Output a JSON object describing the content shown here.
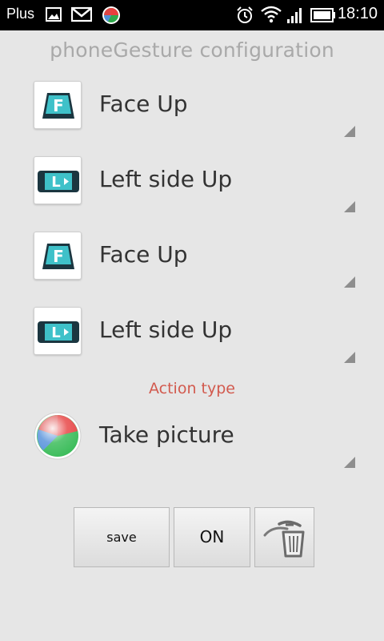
{
  "status_bar": {
    "carrier": "Plus",
    "time": "18:10",
    "icons": [
      "image-icon",
      "gmail-icon",
      "app-orb-icon",
      "alarm-icon",
      "wifi-icon",
      "signal-icon",
      "battery-icon"
    ]
  },
  "title": "phoneGesture configuration",
  "gestures": [
    {
      "icon": "face-up-icon",
      "icon_letter": "F",
      "label": "Face Up"
    },
    {
      "icon": "left-side-up-icon",
      "icon_letter": "L",
      "label": "Left side Up"
    },
    {
      "icon": "face-up-icon",
      "icon_letter": "F",
      "label": "Face Up"
    },
    {
      "icon": "left-side-up-icon",
      "icon_letter": "L",
      "label": "Left side Up"
    }
  ],
  "action_section_label": "Action type",
  "action": {
    "icon": "camera-orb-icon",
    "label": "Take picture"
  },
  "buttons": {
    "save_label": "save",
    "toggle_label": "ON",
    "delete_icon": "trash-icon"
  },
  "colors": {
    "background": "#e6e6e6",
    "title": "#a9a9a9",
    "section_label": "#d25a4e",
    "icon_teal": "#3fc1c9",
    "icon_dark": "#1b3640"
  }
}
